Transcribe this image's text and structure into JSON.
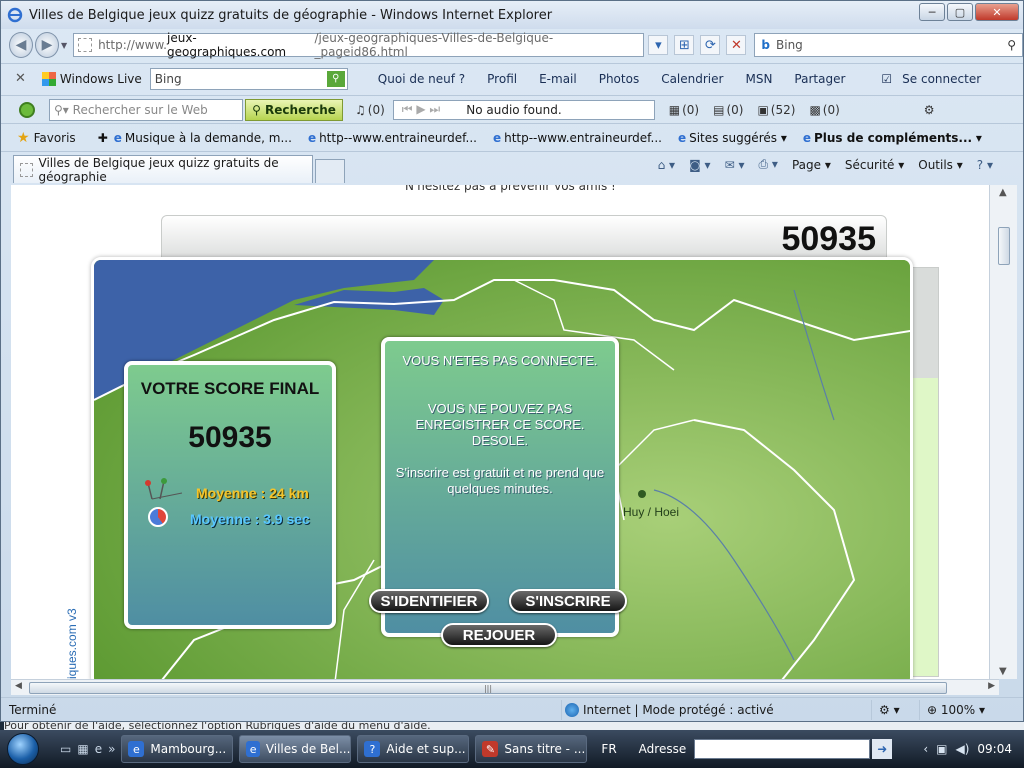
{
  "window": {
    "title": "Villes de Belgique jeux quizz gratuits de géographie - Windows Internet Explorer",
    "minimize": "─",
    "maximize": "▢",
    "close": "✕"
  },
  "address": {
    "url_prefix": "http://www.",
    "url_domain": "jeux-geographiques.com",
    "url_path": "/jeux-geographiques-Villes-de-Belgique-_pageid86.html",
    "search_provider": "b",
    "search_placeholder": "Bing"
  },
  "windows_live_bar": {
    "close": "✕",
    "brand": "Windows Live",
    "search_value": "Bing",
    "links": [
      "Quoi de neuf ?",
      "Profil",
      "E-mail",
      "Photos",
      "Calendrier",
      "MSN",
      "Partager"
    ],
    "signin": "Se connecter"
  },
  "search_toolbar": {
    "search_placeholder": "Rechercher sur le Web",
    "search_button": "Recherche",
    "music_count": "(0)",
    "player_text": "No audio found.",
    "counters": [
      "(0)",
      "(0)",
      "(52)",
      "(0)"
    ]
  },
  "favorites_bar": {
    "favorites": "Favoris",
    "items": [
      "Musique à la demande, m...",
      "http--www.entraineurdef...",
      "http--www.entraineurdef...",
      "Sites suggérés",
      "Plus de compléments..."
    ]
  },
  "tabs": {
    "active_tab": "Villes de Belgique jeux quizz gratuits de géographie"
  },
  "command_bar": {
    "page": "Page",
    "security": "Sécurité",
    "tools": "Outils"
  },
  "page": {
    "top_text": "N'hésitez pas à prévenir vos amis !",
    "score_display": "50935",
    "brand_vertical": "iques.com v3",
    "city_label": "Huy / Hoei",
    "score_card": {
      "heading": "VOTRE SCORE FINAL",
      "score": "50935",
      "distance_avg": "Moyenne : 24 km",
      "time_avg": "Moyenne : 3.9 sec"
    },
    "message_card": {
      "line1": "VOUS N'ETES PAS CONNECTE.",
      "line2": "VOUS NE POUVEZ PAS ENREGISTRER CE SCORE. DESOLE.",
      "line3": "S'inscrire est gratuit et ne prend que quelques minutes."
    },
    "buttons": {
      "login": "S'IDENTIFIER",
      "register": "S'INSCRIRE",
      "replay": "REJOUER"
    }
  },
  "statusbar": {
    "status": "Terminé",
    "zone": "Internet | Mode protégé : activé",
    "zoom": "100%"
  },
  "help_text": "Pour obtenir de l'aide, sélectionnez l'option Rubriques d'aide du menu d'aide.",
  "taskbar": {
    "tasks": [
      "Mambourg...",
      "Villes de Bel...",
      "Aide et sup...",
      "Sans titre - ..."
    ],
    "lang": "FR",
    "address_label": "Adresse",
    "time": "09:04"
  },
  "colors": {
    "score_gold": "#f5c42a",
    "score_blue": "#59c7ff",
    "map_green": "#6aa93a",
    "sea_blue": "#3d62a8"
  }
}
